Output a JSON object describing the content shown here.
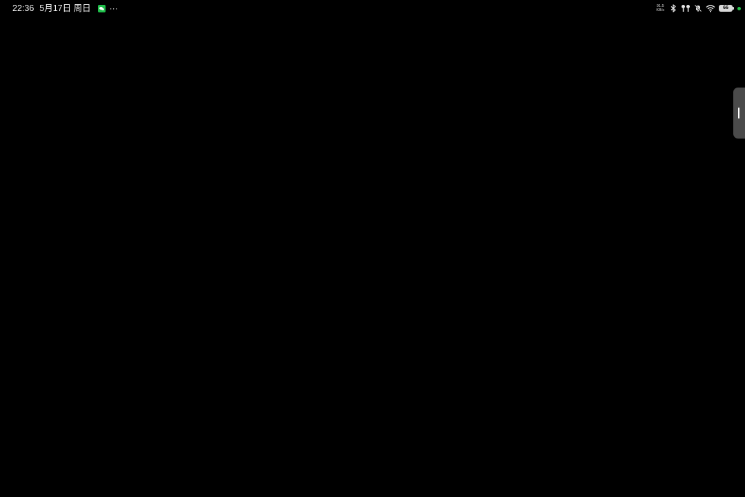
{
  "status_bar": {
    "time": "22:36",
    "date": "5月17日 周日",
    "notification_icons": [
      "wechat-icon"
    ],
    "more_glyph": "···",
    "net_speed_value": "91.5",
    "net_speed_unit": "KB/s",
    "system_icons": [
      "bluetooth-icon",
      "headphones-icon",
      "mute-icon",
      "wifi-icon"
    ],
    "battery_level": "66",
    "accent_green": "#27c24c"
  },
  "screen": {
    "background": "#000000"
  }
}
